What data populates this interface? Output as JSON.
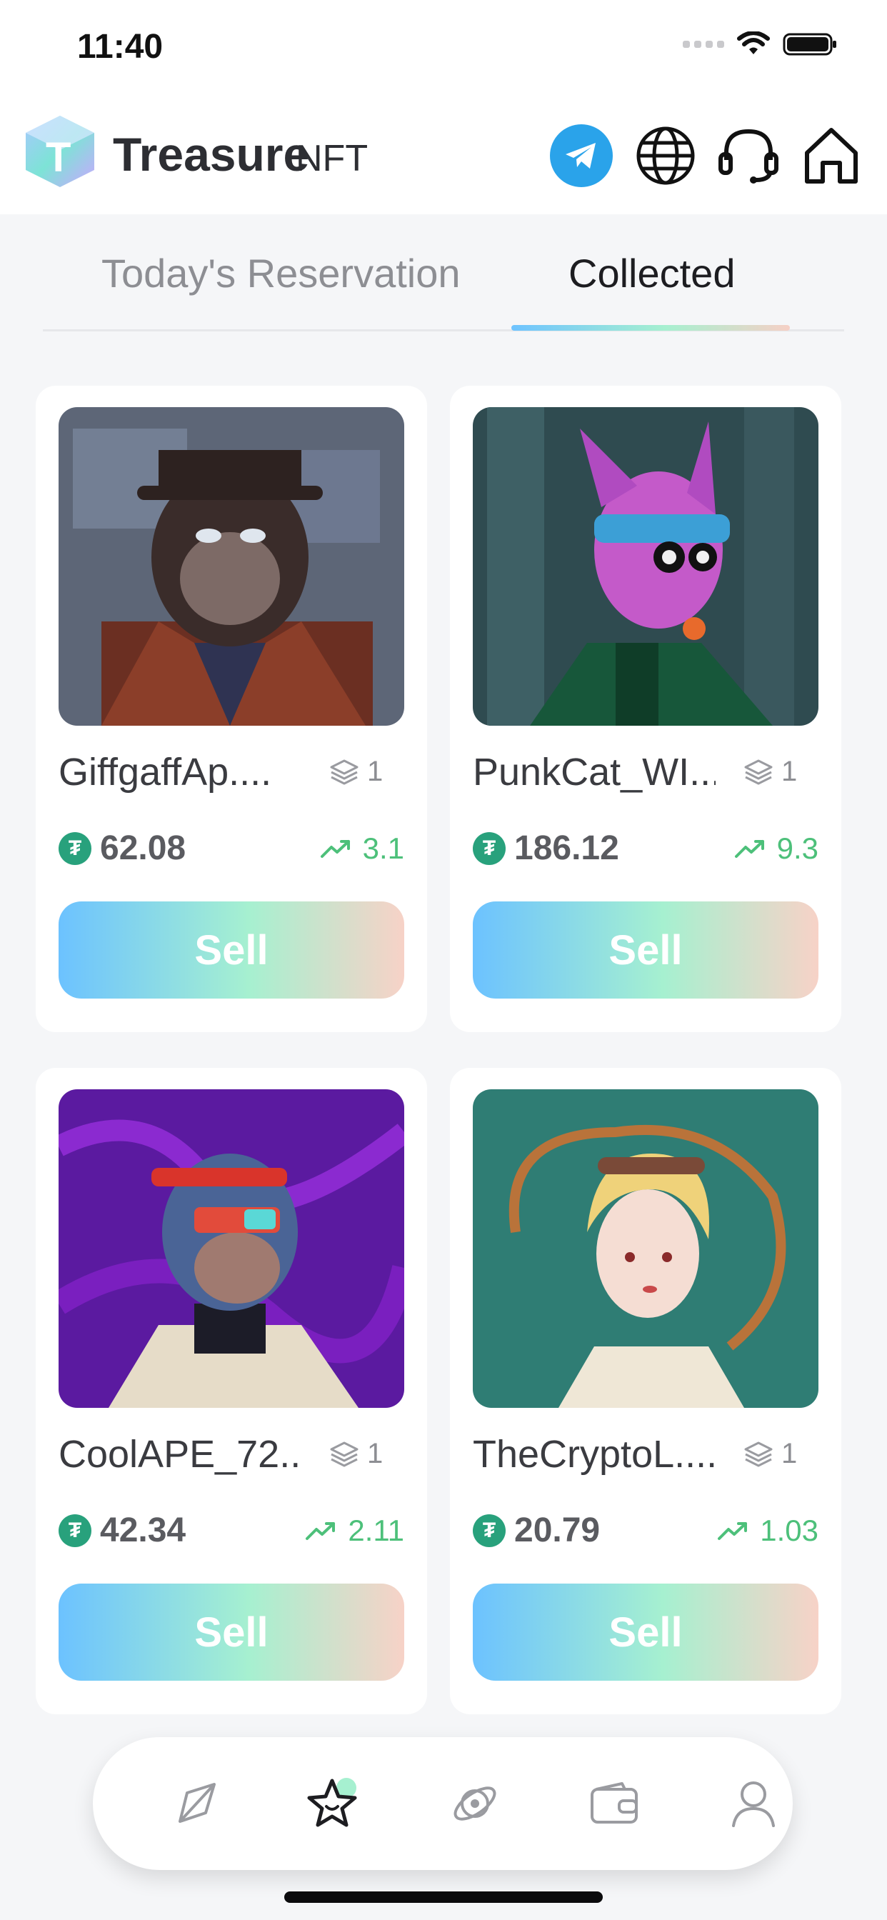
{
  "status_bar": {
    "time": "11:40"
  },
  "header": {
    "brand": "Treasure",
    "brand_suffix": "NFT",
    "icons": [
      "telegram-icon",
      "globe-icon",
      "headset-icon",
      "home-icon"
    ]
  },
  "tabs": [
    {
      "label": "Today's Reservation",
      "active": false
    },
    {
      "label": "Collected",
      "active": true
    }
  ],
  "cards": [
    {
      "name": "GiffgaffAp....",
      "layers": "1",
      "price": "62.08",
      "change": "3.1",
      "sell_label": "Sell"
    },
    {
      "name": "PunkCat_WI....",
      "layers": "1",
      "price": "186.12",
      "change": "9.3",
      "sell_label": "Sell"
    },
    {
      "name": "CoolAPE_72....",
      "layers": "1",
      "price": "42.34",
      "change": "2.11",
      "sell_label": "Sell"
    },
    {
      "name": "TheCryptoL....",
      "layers": "1",
      "price": "20.79",
      "change": "1.03",
      "sell_label": "Sell"
    }
  ],
  "bottom_nav": {
    "items": [
      "explore-icon",
      "collection-star-icon",
      "orbit-icon",
      "wallet-icon",
      "profile-icon"
    ],
    "active_index": 1
  },
  "colors": {
    "accent_blue": "#6cc2ff",
    "accent_mint": "#a6f0d0",
    "accent_peach": "#f7d2c7",
    "usdt_green": "#28a17c",
    "trend_green": "#4dc07a",
    "telegram_blue": "#2aa3ea"
  }
}
